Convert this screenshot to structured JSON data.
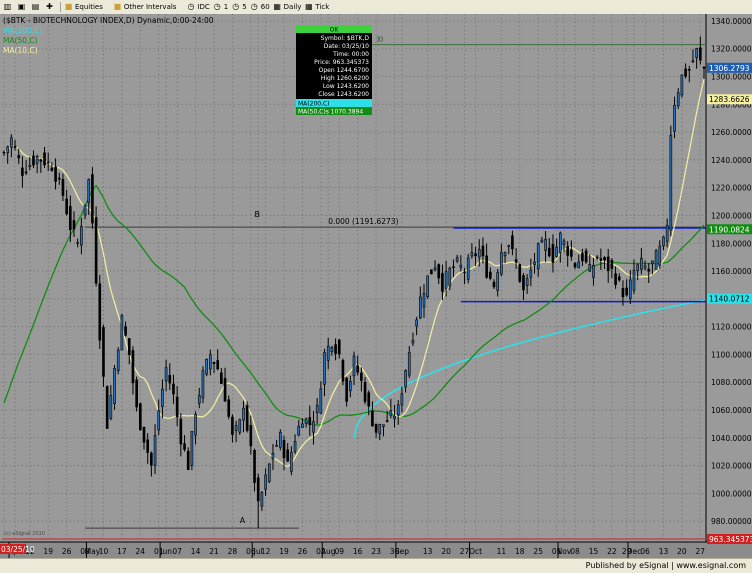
{
  "toolbar": {
    "items": [
      "Equities",
      "Other Intervals",
      "IDC",
      "1",
      "5",
      "60",
      "Daily",
      "Tick"
    ]
  },
  "footer": {
    "text": "Published by eSignal | www.esignal.com"
  },
  "chart_data": {
    "type": "candlestick",
    "title": "($BTK - BIOTECHNOLOGY INDEX,D) Dynamic,0:00-24:00",
    "legend": [
      "MA(200,C)",
      "MA(50,C)",
      "MA(10,C)"
    ],
    "y_ticks": [
      980,
      1000,
      1020,
      1040,
      1060,
      1080,
      1100,
      1120,
      1140,
      1160,
      1180,
      1200,
      1220,
      1240,
      1260,
      1280,
      1300,
      1320,
      1340
    ],
    "ylim": [
      965,
      1345
    ],
    "x_ticks": [
      {
        "label": "29",
        "i": 0
      },
      {
        "label": "Apr",
        "i": 3
      },
      {
        "label": "12",
        "i": 7
      },
      {
        "label": "19",
        "i": 12
      },
      {
        "label": "26",
        "i": 17
      },
      {
        "label": "03",
        "i": 22
      },
      {
        "label": "May",
        "i": 24
      },
      {
        "label": "10",
        "i": 27
      },
      {
        "label": "17",
        "i": 32
      },
      {
        "label": "24",
        "i": 37
      },
      {
        "label": "01",
        "i": 42
      },
      {
        "label": "Jun",
        "i": 44
      },
      {
        "label": "07",
        "i": 47
      },
      {
        "label": "14",
        "i": 52
      },
      {
        "label": "21",
        "i": 57
      },
      {
        "label": "28",
        "i": 62
      },
      {
        "label": "06",
        "i": 67
      },
      {
        "label": "Jul",
        "i": 69
      },
      {
        "label": "12",
        "i": 71
      },
      {
        "label": "19",
        "i": 76
      },
      {
        "label": "26",
        "i": 81
      },
      {
        "label": "02",
        "i": 86
      },
      {
        "label": "Aug",
        "i": 88
      },
      {
        "label": "09",
        "i": 91
      },
      {
        "label": "16",
        "i": 96
      },
      {
        "label": "23",
        "i": 101
      },
      {
        "label": "30",
        "i": 106
      },
      {
        "label": "Sep",
        "i": 108
      },
      {
        "label": "13",
        "i": 115
      },
      {
        "label": "20",
        "i": 120
      },
      {
        "label": "27",
        "i": 125
      },
      {
        "label": "Oct",
        "i": 128
      },
      {
        "label": "11",
        "i": 135
      },
      {
        "label": "18",
        "i": 140
      },
      {
        "label": "25",
        "i": 145
      },
      {
        "label": "01",
        "i": 150
      },
      {
        "label": "Nov",
        "i": 152
      },
      {
        "label": "08",
        "i": 155
      },
      {
        "label": "15",
        "i": 160
      },
      {
        "label": "22",
        "i": 165
      },
      {
        "label": "29",
        "i": 169
      },
      {
        "label": "Dec",
        "i": 171
      },
      {
        "label": "06",
        "i": 174
      },
      {
        "label": "13",
        "i": 179
      },
      {
        "label": "20",
        "i": 184
      },
      {
        "label": "27",
        "i": 189
      }
    ],
    "anchors": [
      [
        0,
        1245
      ],
      [
        2,
        1255
      ],
      [
        5,
        1232
      ],
      [
        9,
        1242
      ],
      [
        13,
        1236
      ],
      [
        16,
        1215
      ],
      [
        18,
        1192
      ],
      [
        20,
        1180
      ],
      [
        22,
        1210
      ],
      [
        23,
        1225
      ],
      [
        24,
        1195
      ],
      [
        26,
        1115
      ],
      [
        28,
        1050
      ],
      [
        30,
        1090
      ],
      [
        32,
        1125
      ],
      [
        34,
        1100
      ],
      [
        36,
        1060
      ],
      [
        38,
        1040
      ],
      [
        40,
        1020
      ],
      [
        42,
        1060
      ],
      [
        44,
        1090
      ],
      [
        46,
        1070
      ],
      [
        48,
        1040
      ],
      [
        50,
        1020
      ],
      [
        52,
        1060
      ],
      [
        54,
        1085
      ],
      [
        56,
        1100
      ],
      [
        58,
        1090
      ],
      [
        60,
        1070
      ],
      [
        62,
        1040
      ],
      [
        64,
        1050
      ],
      [
        65,
        1065
      ],
      [
        67,
        1030
      ],
      [
        68,
        1010
      ],
      [
        69,
        990
      ],
      [
        71,
        1010
      ],
      [
        73,
        1030
      ],
      [
        75,
        1040
      ],
      [
        77,
        1020
      ],
      [
        79,
        1040
      ],
      [
        81,
        1055
      ],
      [
        83,
        1050
      ],
      [
        85,
        1060
      ],
      [
        87,
        1100
      ],
      [
        89,
        1110
      ],
      [
        91,
        1100
      ],
      [
        93,
        1070
      ],
      [
        95,
        1095
      ],
      [
        97,
        1080
      ],
      [
        99,
        1060
      ],
      [
        101,
        1045
      ],
      [
        103,
        1050
      ],
      [
        105,
        1055
      ],
      [
        107,
        1060
      ],
      [
        109,
        1090
      ],
      [
        111,
        1115
      ],
      [
        113,
        1140
      ],
      [
        115,
        1155
      ],
      [
        117,
        1165
      ],
      [
        119,
        1150
      ],
      [
        121,
        1160
      ],
      [
        123,
        1165
      ],
      [
        125,
        1160
      ],
      [
        127,
        1170
      ],
      [
        129,
        1175
      ],
      [
        131,
        1160
      ],
      [
        133,
        1150
      ],
      [
        135,
        1175
      ],
      [
        137,
        1180
      ],
      [
        139,
        1165
      ],
      [
        141,
        1145
      ],
      [
        143,
        1160
      ],
      [
        145,
        1175
      ],
      [
        147,
        1180
      ],
      [
        149,
        1170
      ],
      [
        151,
        1185
      ],
      [
        153,
        1175
      ],
      [
        155,
        1165
      ],
      [
        157,
        1170
      ],
      [
        159,
        1160
      ],
      [
        161,
        1170
      ],
      [
        163,
        1165
      ],
      [
        165,
        1160
      ],
      [
        167,
        1150
      ],
      [
        169,
        1140
      ],
      [
        171,
        1160
      ],
      [
        173,
        1165
      ],
      [
        175,
        1160
      ],
      [
        177,
        1170
      ],
      [
        179,
        1180
      ],
      [
        180,
        1195
      ],
      [
        181,
        1260
      ],
      [
        182,
        1282
      ],
      [
        184,
        1300
      ],
      [
        186,
        1305
      ],
      [
        188,
        1318
      ],
      [
        189,
        1310
      ],
      [
        190,
        1306
      ]
    ],
    "last_price_label": "1306.2793",
    "ma10_label": "1283.6626",
    "ma50_label": "1190.0824",
    "ma200_label": "1140.0712",
    "bottom_label": "963.345373",
    "date_label": "03/25/10",
    "fib_label": "0.000 (1191.6273)",
    "fib_level": 1191.6273,
    "label_A": "A",
    "label_B": "B",
    "label_3": "3)",
    "low_A": 975,
    "channel_top": 1191,
    "channel_bottom": 1138,
    "info_box": {
      "header": "OK",
      "rows": [
        "Symbol: $BTK,D",
        "Date: 03/25/10",
        "Time: 00:00",
        "Price: 963.345373",
        "Open 1244.6700",
        "High 1260.6200",
        "Low 1243.6200",
        "Close 1243.6200"
      ],
      "ma1": "MA(200,C)",
      "ma2": "MA(50,C)s 1070.3894"
    },
    "footnote": "(c) eSignal 2010"
  }
}
